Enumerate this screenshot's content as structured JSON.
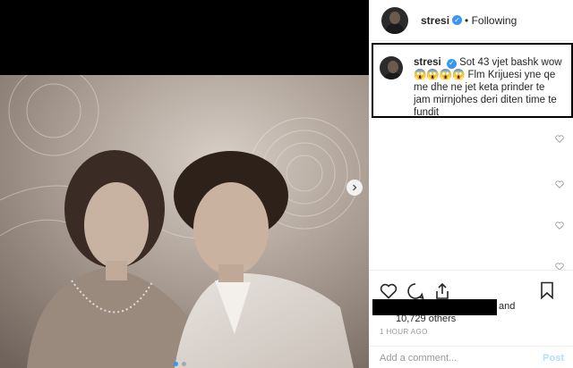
{
  "post": {
    "username": "stresi",
    "follow_status": "Following",
    "caption_username": "stresi",
    "caption_text": "Sot 43 vjet bashk wow 😱😱😱😱 Flm Krijuesi yne qe me dhe ne jet keta prinder te jam mirnjohes deri diten time te fundit",
    "likes_and": "and",
    "likes_others": "10,729 others",
    "timestamp": "1 HOUR AGO",
    "comment_placeholder": "Add a comment...",
    "post_label": "Post",
    "carousel_index": 1,
    "carousel_count": 2
  },
  "colors": {
    "accent": "#3897f0",
    "post_disabled": "#b2dffc",
    "caption_border": "#000000"
  },
  "icons": [
    "next-arrow-icon",
    "verified-badge-icon",
    "heart-icon",
    "comment-icon",
    "share-icon",
    "bookmark-icon"
  ]
}
